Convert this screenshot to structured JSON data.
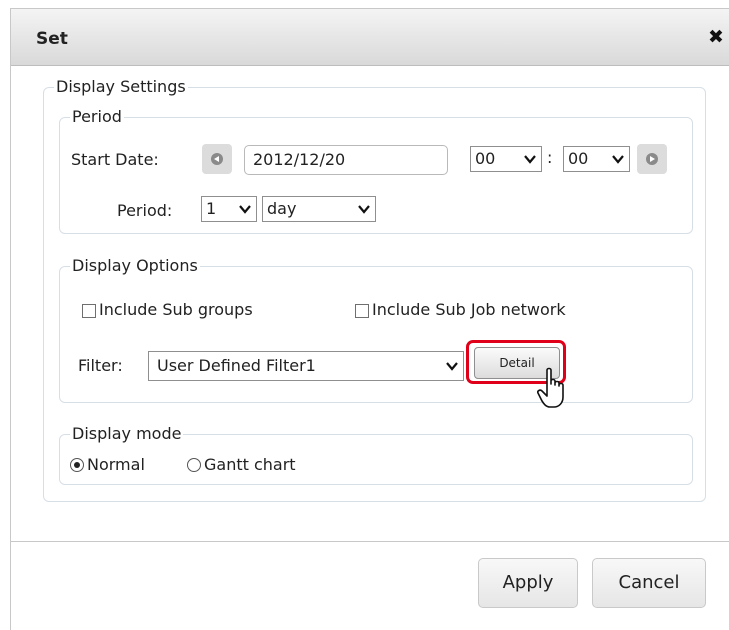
{
  "dialog": {
    "title": "Set",
    "close_glyph": "✖"
  },
  "display_settings": {
    "legend": "Display Settings",
    "period_group": {
      "legend": "Period",
      "start_date_label": "Start Date:",
      "start_date_value": "2012/12/20",
      "hour_value": "00",
      "time_separator": ":",
      "minute_value": "00",
      "period_label": "Period:",
      "period_count": "1",
      "period_unit": "day"
    },
    "options_group": {
      "legend": "Display Options",
      "include_sub_groups_label": "Include Sub groups",
      "include_sub_groups_checked": false,
      "include_sub_job_network_label": "Include Sub Job network",
      "include_sub_job_network_checked": false,
      "filter_label": "Filter:",
      "filter_value": "User Defined Filter1",
      "detail_button": "Detail"
    },
    "mode_group": {
      "legend": "Display mode",
      "normal_label": "Normal",
      "gantt_label": "Gantt chart",
      "selected": "Normal"
    }
  },
  "footer": {
    "apply_label": "Apply",
    "cancel_label": "Cancel"
  },
  "colors": {
    "highlight": "#e0001a",
    "titlebar_top": "#f4f4f4",
    "titlebar_bottom": "#d9d9d9"
  },
  "icons": [
    "close-icon",
    "prev-day-icon",
    "next-day-icon",
    "chevron-down-icon",
    "hand-cursor-icon"
  ]
}
